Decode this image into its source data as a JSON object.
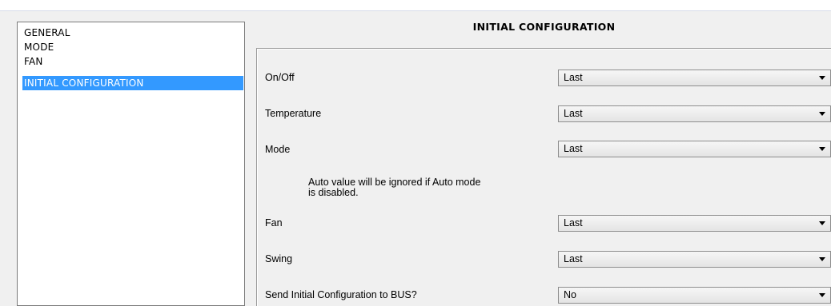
{
  "sidebar": {
    "items": [
      {
        "label": "GENERAL"
      },
      {
        "label": "MODE"
      },
      {
        "label": "FAN"
      },
      {
        "label": "INITIAL CONFIGURATION",
        "selected": true
      }
    ]
  },
  "panel": {
    "title": "INITIAL CONFIGURATION",
    "rows": [
      {
        "label": "On/Off",
        "value": "Last"
      },
      {
        "label": "Temperature",
        "value": "Last"
      },
      {
        "label": "Mode",
        "value": "Last"
      },
      {
        "label": "Fan",
        "value": "Last"
      },
      {
        "label": "Swing",
        "value": "Last"
      },
      {
        "label": "Send Initial Configuration to BUS?",
        "value": "No"
      }
    ],
    "note": {
      "line1": "Auto value will be ignored if Auto mode",
      "line2": "is disabled."
    }
  },
  "colors": {
    "selection": "#3399ff",
    "background": "#f0f0f0",
    "border": "#7a7a7a"
  },
  "icons": {
    "dropdown": "chevron-down-icon"
  }
}
